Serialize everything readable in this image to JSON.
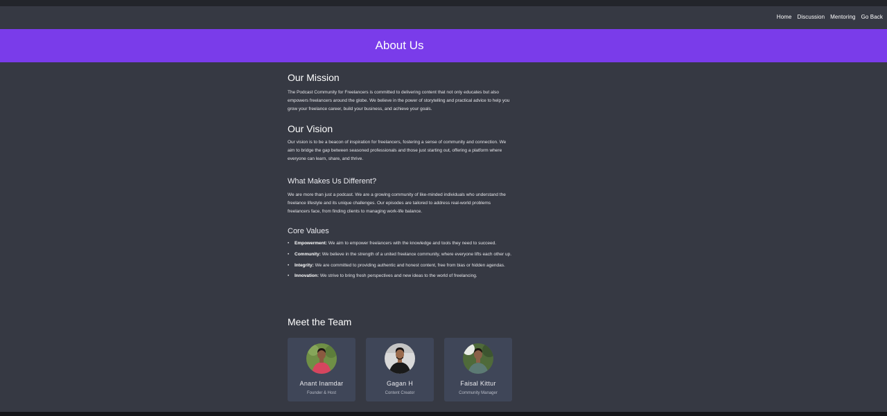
{
  "nav": {
    "links": [
      "Home",
      "Discussion",
      "Mentoring",
      "Go Back"
    ]
  },
  "banner": {
    "title": "About Us"
  },
  "mission": {
    "heading": "Our Mission",
    "text": "The Podcast Community for Freelancers is committed to delivering content that not only educates but also empowers freelancers around the globe. We believe in the power of storytelling and practical advice to help you grow your freelance career, build your business, and achieve your goals."
  },
  "vision": {
    "heading": "Our Vision",
    "text": "Our vision is to be a beacon of inspiration for freelancers, fostering a sense of community and connection. We aim to bridge the gap between seasoned professionals and those just starting out, offering a platform where everyone can learn, share, and thrive."
  },
  "different": {
    "heading": "What Makes Us Different?",
    "text": "We are more than just a podcast. We are a growing community of like-minded individuals who understand the freelance lifestyle and its unique challenges. Our episodes are tailored to address real-world problems freelancers face, from finding clients to managing work-life balance."
  },
  "values": {
    "heading": "Core Values",
    "items": [
      {
        "term": "Empowerment:",
        "text": " We aim to empower freelancers with the knowledge and tools they need to succeed."
      },
      {
        "term": "Community:",
        "text": " We believe in the strength of a united freelance community, where everyone lifts each other up."
      },
      {
        "term": "Integrity:",
        "text": " We are committed to providing authentic and honest content, free from bias or hidden agendas."
      },
      {
        "term": "Innovation:",
        "text": " We strive to bring fresh perspectives and new ideas to the world of freelancing."
      }
    ]
  },
  "team": {
    "heading": "Meet the Team",
    "members": [
      {
        "name": "Anant Inamdar",
        "role": "Founder & Host",
        "colors": {
          "bg": "#6f8f46",
          "shirt": "#d6455f",
          "skin": "#8a5a40",
          "hair": "#1d1512"
        }
      },
      {
        "name": "Gagan H",
        "role": "Content Creator",
        "colors": {
          "bg": "#d9d9d9",
          "shirt": "#1a1a1a",
          "skin": "#9a6a4c",
          "hair": "#151010"
        }
      },
      {
        "name": "Faisal Kittur",
        "role": "Community Manager",
        "colors": {
          "bg": "#4f6a3a",
          "shirt": "#5c7a74",
          "skin": "#8a6048",
          "hair": "#1a1410"
        }
      }
    ]
  }
}
